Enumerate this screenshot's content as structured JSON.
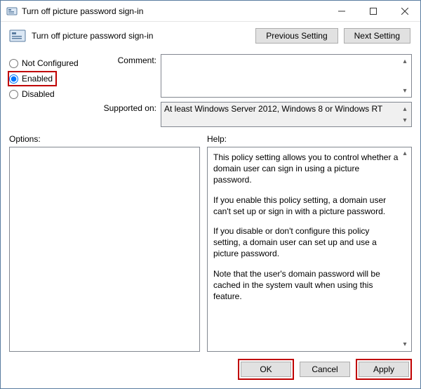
{
  "window": {
    "title": "Turn off picture password sign-in"
  },
  "header": {
    "label": "Turn off picture password sign-in",
    "prev": "Previous Setting",
    "next": "Next Setting"
  },
  "radios": {
    "not_configured": "Not Configured",
    "enabled": "Enabled",
    "disabled": "Disabled",
    "selected": "enabled"
  },
  "fields": {
    "comment_label": "Comment:",
    "comment_value": "",
    "supported_label": "Supported on:",
    "supported_value": "At least Windows Server 2012, Windows 8 or Windows RT"
  },
  "panes": {
    "options_label": "Options:",
    "help_label": "Help:",
    "help_paragraphs": [
      "This policy setting allows you to control whether a domain user can sign in using a picture password.",
      "If you enable this policy setting, a domain user can't set up or sign in with a picture password.",
      "If you disable or don't configure this policy setting, a domain user can set up and use a picture password.",
      "Note that the user's domain password will be cached in the system vault when using this feature."
    ]
  },
  "footer": {
    "ok": "OK",
    "cancel": "Cancel",
    "apply": "Apply"
  }
}
